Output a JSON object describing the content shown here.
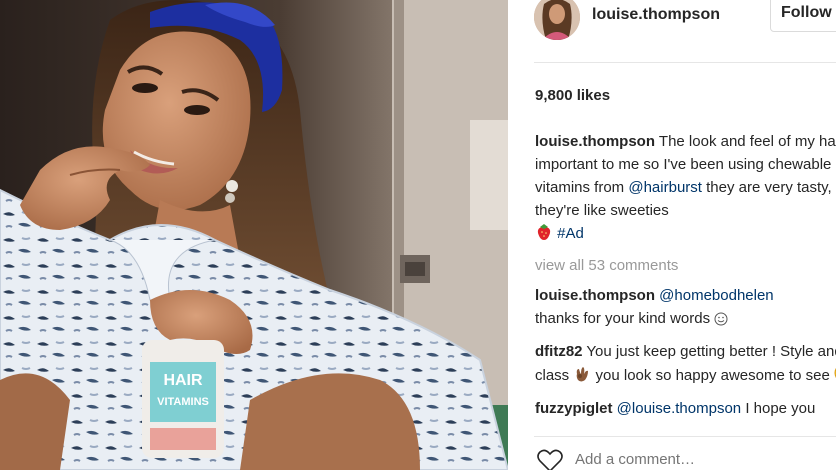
{
  "post": {
    "username": "louise.thompson",
    "follow_label": "Follow",
    "likes": "9,800 likes",
    "caption": {
      "user": "louise.thompson",
      "text_1": "The look and feel of my hair is important to me so I've been using chewable hair vitamins from",
      "mention": "@hairburst",
      "text_2": "they are very tasty, they're like sweeties",
      "hashtag": "#Ad"
    },
    "view_all": "view all 53 comments",
    "comments": [
      {
        "user": "louise.thompson",
        "mention": "@homebodhelen",
        "text": "thanks for your kind words"
      },
      {
        "user": "dfitz82",
        "text_1": "You just keep getting better ! Style and class",
        "text_2": "you look so happy awesome to see"
      },
      {
        "user": "fuzzypiglet",
        "mention": "@louise.thompson",
        "text": "I hope you"
      }
    ],
    "add_comment_placeholder": "Add a comment…",
    "product_label": [
      "HAIR",
      "VITAMINS"
    ]
  },
  "icons": {
    "strawberry": "strawberry-emoji",
    "smile": "smile-emoji",
    "ok_hand": "ok-hand-emoji",
    "grin": "grin-emoji",
    "heart": "heart-outline-icon"
  },
  "colors": {
    "link": "#003569",
    "muted": "#999999",
    "text": "#262626",
    "border": "#dbdbdb"
  }
}
